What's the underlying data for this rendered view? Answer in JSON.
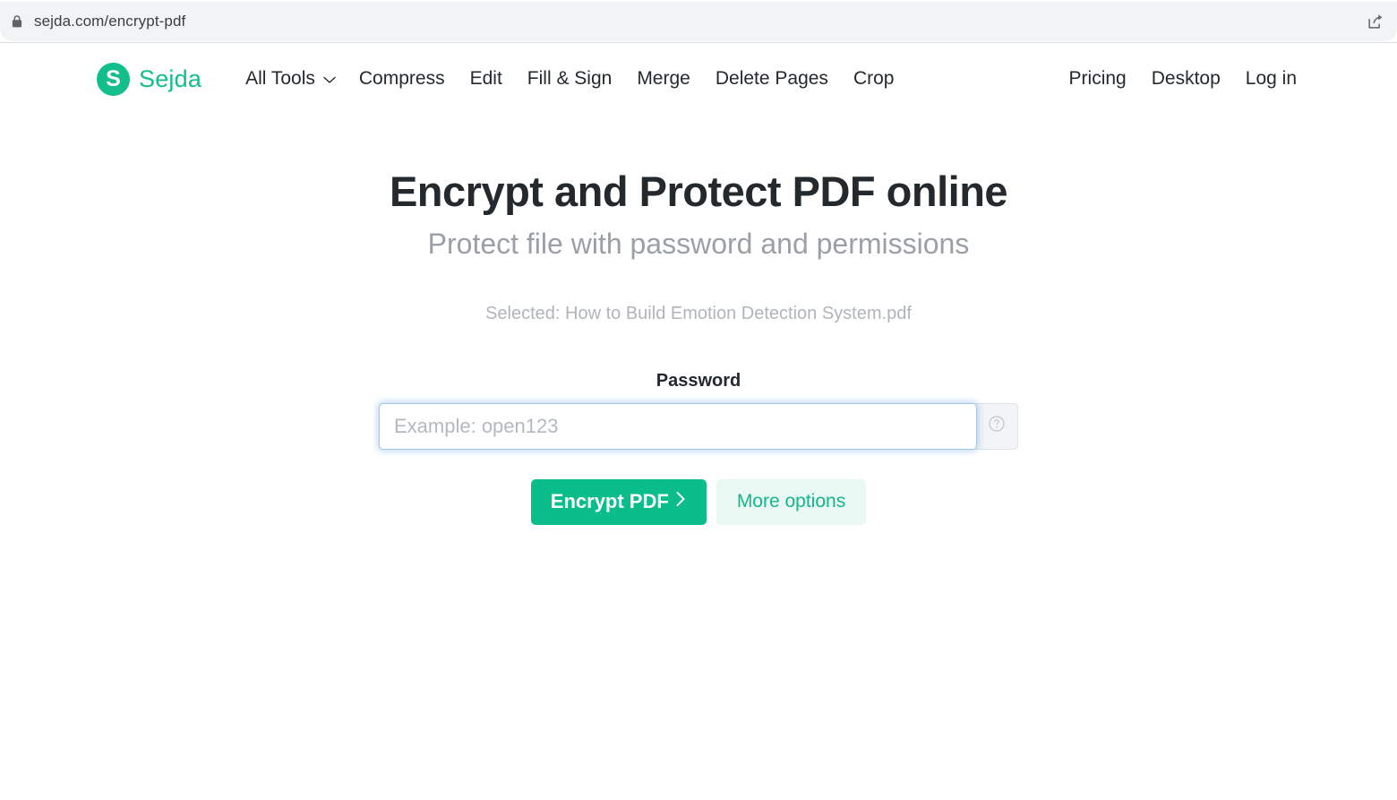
{
  "browser": {
    "url": "sejda.com/encrypt-pdf",
    "lock_icon": "lock-icon",
    "share_icon": "share-icon"
  },
  "header": {
    "brand": {
      "mark": "S",
      "name": "Sejda",
      "color": "#13bd8c"
    },
    "primary_nav": {
      "all_tools": "All Tools",
      "chevron_icon": "chevron-down-icon",
      "items": [
        "Compress",
        "Edit",
        "Fill & Sign",
        "Merge",
        "Delete Pages",
        "Crop"
      ]
    },
    "secondary_nav": {
      "items": [
        "Pricing",
        "Desktop",
        "Log in"
      ]
    }
  },
  "main": {
    "title": "Encrypt and Protect PDF online",
    "subtitle": "Protect file with password and permissions",
    "selected_file": "Selected: How to Build Emotion Detection System.pdf",
    "password_label": "Password",
    "password_value": "",
    "password_placeholder": "Example: open123",
    "help_icon": "question-mark-circle-icon",
    "encrypt_button": "Encrypt PDF",
    "encrypt_button_chevron": "chevron-right-icon",
    "more_options_button": "More options"
  },
  "colors": {
    "brand_green": "#13bd8c",
    "button_green": "#0cbd8c",
    "button_light_green_bg": "#e9f8f2",
    "focus_blue": "#78afeb",
    "muted_text": "#9aa0a6"
  }
}
